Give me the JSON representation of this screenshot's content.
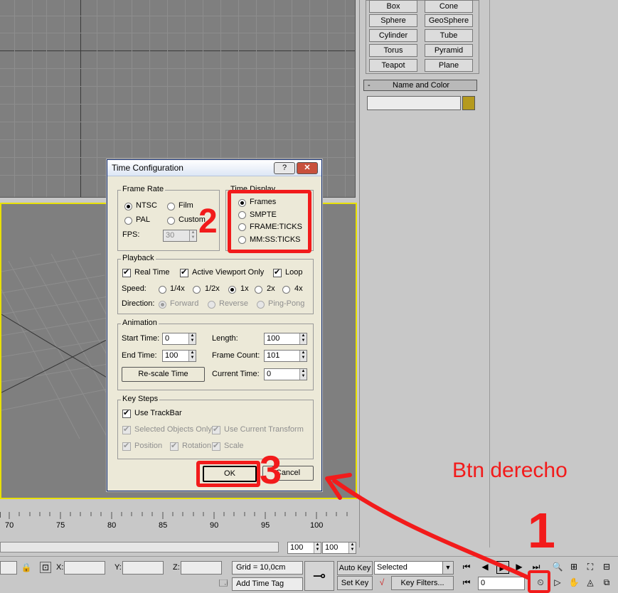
{
  "primitives": [
    "Box",
    "Cone",
    "Sphere",
    "GeoSphere",
    "Cylinder",
    "Tube",
    "Torus",
    "Pyramid",
    "Teapot",
    "Plane"
  ],
  "name_color": {
    "title": "Name and Color",
    "collapse": "-"
  },
  "dialog": {
    "title": "Time Configuration",
    "help": "?",
    "close": "✕",
    "frame_rate": {
      "label": "Frame Rate",
      "ntsc": "NTSC",
      "film": "Film",
      "pal": "PAL",
      "custom": "Custom",
      "fps_label": "FPS:",
      "fps": "30"
    },
    "time_display": {
      "label": "Time Display",
      "frames": "Frames",
      "smpte": "SMPTE",
      "frame_ticks": "FRAME:TICKS",
      "mmss": "MM:SS:TICKS"
    },
    "playback": {
      "label": "Playback",
      "real_time": "Real Time",
      "active_viewport": "Active Viewport Only",
      "loop": "Loop",
      "speed_label": "Speed:",
      "s1": "1/4x",
      "s2": "1/2x",
      "s3": "1x",
      "s4": "2x",
      "s5": "4x",
      "direction_label": "Direction:",
      "forward": "Forward",
      "reverse": "Reverse",
      "pingpong": "Ping-Pong"
    },
    "animation": {
      "label": "Animation",
      "start_label": "Start Time:",
      "start": "0",
      "length_label": "Length:",
      "length": "100",
      "end_label": "End Time:",
      "end": "100",
      "frame_count_label": "Frame Count:",
      "frame_count": "101",
      "rescale": "Re-scale Time",
      "current_label": "Current Time:",
      "current": "0"
    },
    "key_steps": {
      "label": "Key Steps",
      "use_trackbar": "Use TrackBar",
      "selected_only": "Selected Objects Only",
      "use_current": "Use Current Transform",
      "position": "Position",
      "rotation": "Rotation",
      "scale": "Scale"
    },
    "ok": "OK",
    "cancel": "Cancel"
  },
  "ruler": [
    "70",
    "75",
    "80",
    "85",
    "90",
    "95",
    "100"
  ],
  "slider": {
    "a": "100",
    "b": "100"
  },
  "status": {
    "x_label": "X:",
    "y_label": "Y:",
    "z_label": "Z:",
    "grid": "Grid = 10,0cm",
    "add_time_tag": "Add Time Tag",
    "auto_key": "Auto Key",
    "set_key": "Set Key",
    "selected": "Selected",
    "key_filters": "Key Filters...",
    "frame": "0"
  },
  "annotations": {
    "text": "Btn derecho",
    "n1": "1",
    "n2": "2",
    "n3": "3"
  },
  "colors": {
    "annotation": "#f21b1b",
    "viewport": "#7f7f7f",
    "active_border": "#e8e000"
  }
}
